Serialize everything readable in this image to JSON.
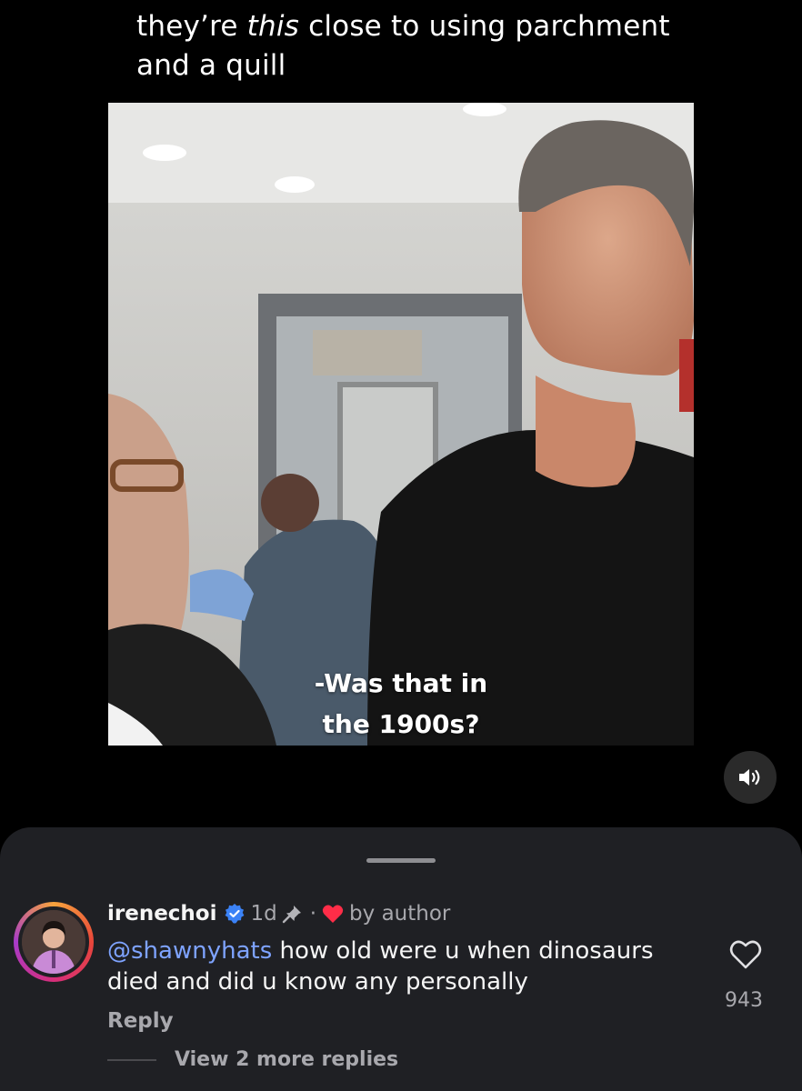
{
  "caption": {
    "before": "they’re ",
    "emphasis": "this",
    "after": " close to using parchment and a quill"
  },
  "video": {
    "subtitle_line1": "-Was that in",
    "subtitle_line2": "the 1900s?"
  },
  "sound_button": {
    "icon": "speaker-wave-icon"
  },
  "comment": {
    "username": "irenechoi",
    "verified_icon": "verified-badge-icon",
    "time": "1d",
    "pinned_icon": "pin-icon",
    "separator": "·",
    "liked_by_author_icon": "red-heart-icon",
    "liked_by_author_label": "by author",
    "mention": "@shawnyhats",
    "text": " how old were u when dinosaurs died and did u know any personally",
    "reply_label": "Reply",
    "like_icon": "heart-outline-icon",
    "like_count": "943",
    "view_replies_label": "View 2 more replies"
  },
  "colors": {
    "mention": "#7ea3ff",
    "sheet_background": "#1f2024",
    "verified": "#3b82f6",
    "heart": "#ff2d48"
  }
}
